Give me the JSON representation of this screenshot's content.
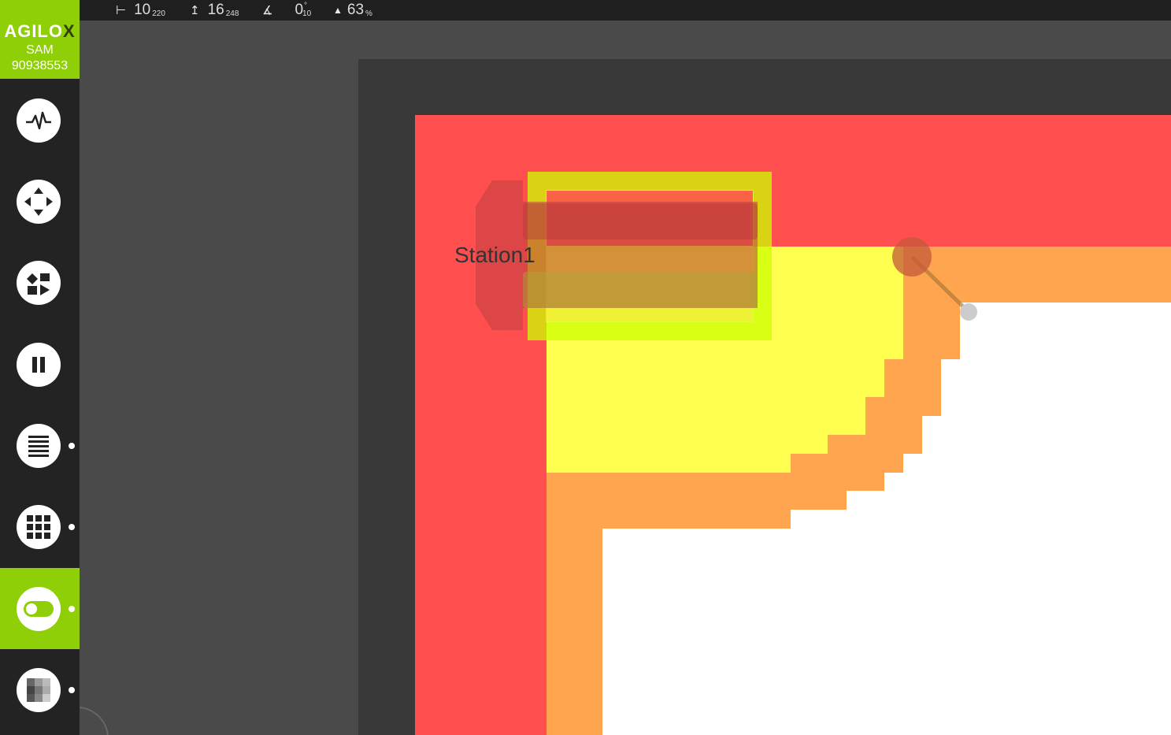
{
  "status_bar": {
    "items": [
      {
        "icon": "x-position-icon",
        "glyph": "⊢",
        "value": "10",
        "sub": "220"
      },
      {
        "icon": "y-position-icon",
        "glyph": "↥",
        "value": "16",
        "sub": "248"
      },
      {
        "icon": "angle-icon",
        "glyph": "∡",
        "value": "0",
        "sup": "°",
        "sub": "10"
      },
      {
        "icon": "battery-arrow-icon",
        "glyph": "▲",
        "value": "63",
        "sub": "%"
      }
    ]
  },
  "brand": {
    "name_main": "AGILO",
    "name_x": "X",
    "model": "SAM",
    "serial": "90938553",
    "color": "#8ecf07"
  },
  "nav": [
    {
      "icon": "pulse-icon",
      "active": false,
      "dot": false
    },
    {
      "icon": "move-arrows-icon",
      "active": false,
      "dot": false
    },
    {
      "icon": "workflow-icon",
      "active": false,
      "dot": false
    },
    {
      "icon": "pause-icon",
      "active": false,
      "dot": false
    },
    {
      "icon": "list-icon",
      "active": false,
      "dot": true
    },
    {
      "icon": "grid-icon",
      "active": false,
      "dot": true
    },
    {
      "icon": "toggle-icon",
      "active": true,
      "dot": true
    },
    {
      "icon": "checkerboard-icon",
      "active": false,
      "dot": true
    }
  ],
  "map": {
    "station_label": "Station1",
    "colors": {
      "outer": "#383838",
      "red_zone": "#ff4f4f",
      "orange_zone": "#ffa44f",
      "yellow_zone": "#ffff4f",
      "free": "#ffffff",
      "station_highlight": "#ccff00"
    }
  }
}
